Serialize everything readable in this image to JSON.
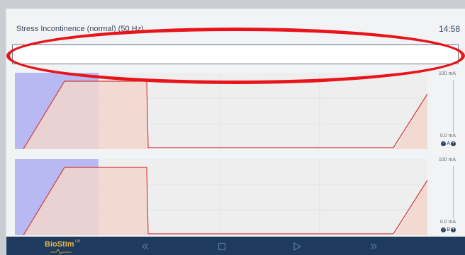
{
  "header": {
    "program_title": "Stress Incontinence (normal) (50 Hz)",
    "clock": "14:58"
  },
  "message_bar": {
    "text": ""
  },
  "channels": [
    {
      "name": "A",
      "scale_max": "100 mA",
      "scale_zero": "0.0 mA"
    },
    {
      "name": "B",
      "scale_max": "100 mA",
      "scale_zero": "0.0 mA"
    }
  ],
  "channel_controls": {
    "decrease": "−",
    "increase": "+"
  },
  "footer": {
    "logo_text": "BioStim",
    "logo_sup": "LW",
    "controls": [
      "rewind",
      "stop",
      "play",
      "fast-forward"
    ]
  },
  "colors": {
    "elapsed_overlay": "#b8b9f2",
    "pulse_fill": "#f2d6cc",
    "waveform": "#d23a3a",
    "footer": "#1e3a5c",
    "accent": "#e7b74a",
    "annotation": "#e8141a"
  },
  "icons": [
    "channel-decrease-icon",
    "channel-increase-icon",
    "rewind-icon",
    "stop-icon",
    "play-icon",
    "fast-forward-icon",
    "biostim-logo-icon"
  ]
}
